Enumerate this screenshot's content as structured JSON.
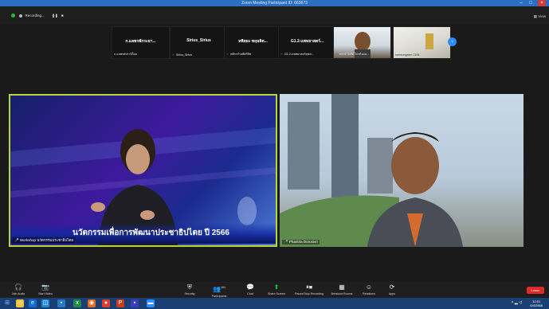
{
  "window": {
    "title": "Zoom Meeting Participant ID: 663673"
  },
  "topbar": {
    "recording_label": "Recording...",
    "view_label": "View"
  },
  "gallery": [
    {
      "name": "ก.แลพรพักระยา...",
      "caption": "ก.แลพรพ่ประบิใดย"
    },
    {
      "name": "Sirius_Sirius",
      "caption": "Sirius_Sirius"
    },
    {
      "name": "หพิฮยะ พฤษลิต...",
      "caption": "หพิรรกำลพิตริสิท"
    },
    {
      "name": "G1.2-แพทยาสตร์...",
      "caption": "G1.2-แพทยาสตร์สุขต..."
    },
    {
      "name": "",
      "caption": "ทรรมี วิภรีย์ โปรกิจอน..."
    },
    {
      "name": "",
      "caption": "samsungcam 2106"
    }
  ],
  "main": {
    "left_label": "Workshop นวัตกรรมประชาธิปไตย",
    "left_banner": "นวัตกรรมเพื่อการพัฒนาประชาธิปไตย ปี 2566",
    "right_label": "Phantira Dorusivri"
  },
  "toolbar": {
    "items": [
      {
        "key": "unmute",
        "label": "Join Audio",
        "icon": "headphones-icon"
      },
      {
        "key": "video",
        "label": "Start Video",
        "icon": "video-off-icon"
      },
      {
        "key": "security",
        "label": "Security",
        "icon": "shield-icon"
      },
      {
        "key": "participants",
        "label": "Participants",
        "icon": "people-icon",
        "count": "101"
      },
      {
        "key": "chat",
        "label": "Chat",
        "icon": "chat-icon"
      },
      {
        "key": "share",
        "label": "Share Screen",
        "icon": "share-screen-icon"
      },
      {
        "key": "record",
        "label": "Pause/Stop Recording",
        "icon": "record-icon"
      },
      {
        "key": "breakout",
        "label": "Breakout Rooms",
        "icon": "grid-icon"
      },
      {
        "key": "reactions",
        "label": "Reactions",
        "icon": "smile-icon"
      },
      {
        "key": "apps",
        "label": "Apps",
        "icon": "apps-icon"
      }
    ],
    "leave_label": "Leave"
  },
  "taskbar": {
    "time": "10:51",
    "date": "6/4/2566"
  },
  "colors": {
    "accent": "#2d8cff",
    "active_border": "#b7d63a",
    "leave": "#e02828",
    "rec": "#19c139"
  }
}
